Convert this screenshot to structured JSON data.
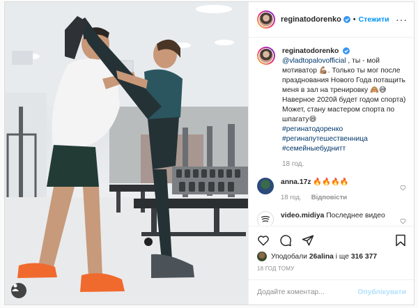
{
  "post": {
    "username": "reginatodorenko",
    "follow_label": "Стежити",
    "caption": {
      "username": "reginatodorenko",
      "mention": "@vladtopalovofficial",
      "text_1": " , ты - мой мотиватор 💪🏽. Только ты мог после празднования Нового Года потащить меня в зал на тренировку 🙈😅",
      "text_2": "Наверное 2020й будет годом спорта) Может, стану мастером спорта по шпагату😄",
      "hashtags": [
        "#регинатодоренко",
        "#регинапутешественница",
        "#семейныебуднитт"
      ],
      "time": "18 год."
    },
    "comments": [
      {
        "username": "anna.17z",
        "text": "🔥🔥🔥🔥",
        "time": "18 год.",
        "reply_label": "Відповісти"
      },
      {
        "username": "video.midiya",
        "text": "Последнее видео"
      }
    ],
    "likes": {
      "prefix": "Уподобали",
      "user": "26alina",
      "middle": "і ще",
      "count": "316 377"
    },
    "time_ago": "18 ГОД ТОМУ",
    "comment_placeholder": "Додайте коментар...",
    "publish_label": "Опублікувати"
  },
  "colors": {
    "accent": "#0095f6",
    "text": "#262626",
    "muted": "#8e8e8e",
    "link": "#00376b",
    "publish_disabled": "#b2dffc"
  },
  "icons": [
    "user-tag-icon",
    "verified-icon",
    "more-icon",
    "heart-icon",
    "comment-icon",
    "share-icon",
    "bookmark-icon"
  ]
}
